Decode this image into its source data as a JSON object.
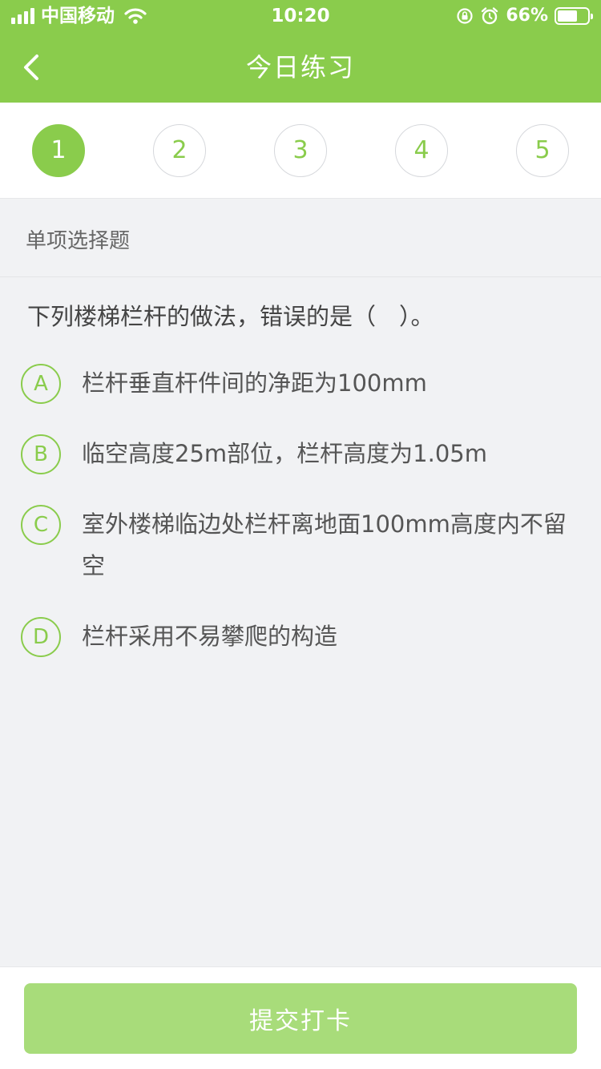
{
  "status_bar": {
    "carrier": "中国移动",
    "time": "10:20",
    "battery_percent": "66%",
    "battery_level": 0.66,
    "icons": [
      "signal-icon",
      "wifi-icon",
      "rotation-lock-icon",
      "alarm-icon",
      "battery-icon"
    ]
  },
  "nav": {
    "back_icon": "chevron-left-icon",
    "title": "今日练习"
  },
  "steps": [
    {
      "label": "1",
      "active": true
    },
    {
      "label": "2",
      "active": false
    },
    {
      "label": "3",
      "active": false
    },
    {
      "label": "4",
      "active": false
    },
    {
      "label": "5",
      "active": false
    }
  ],
  "question_type": "单项选择题",
  "question": "下列楼梯栏杆的做法，错误的是（　）。",
  "options": [
    {
      "letter": "A",
      "text": "栏杆垂直杆件间的净距为100mm"
    },
    {
      "letter": "B",
      "text": "临空高度25m部位，栏杆高度为1.05m"
    },
    {
      "letter": "C",
      "text": "室外楼梯临边处栏杆离地面100mm高度内不留空"
    },
    {
      "letter": "D",
      "text": "栏杆采用不易攀爬的构造"
    }
  ],
  "submit_label": "提交打卡",
  "colors": {
    "accent": "#8acc4c",
    "submit_bg": "#a8dc7a",
    "page_bg": "#f1f2f4"
  }
}
